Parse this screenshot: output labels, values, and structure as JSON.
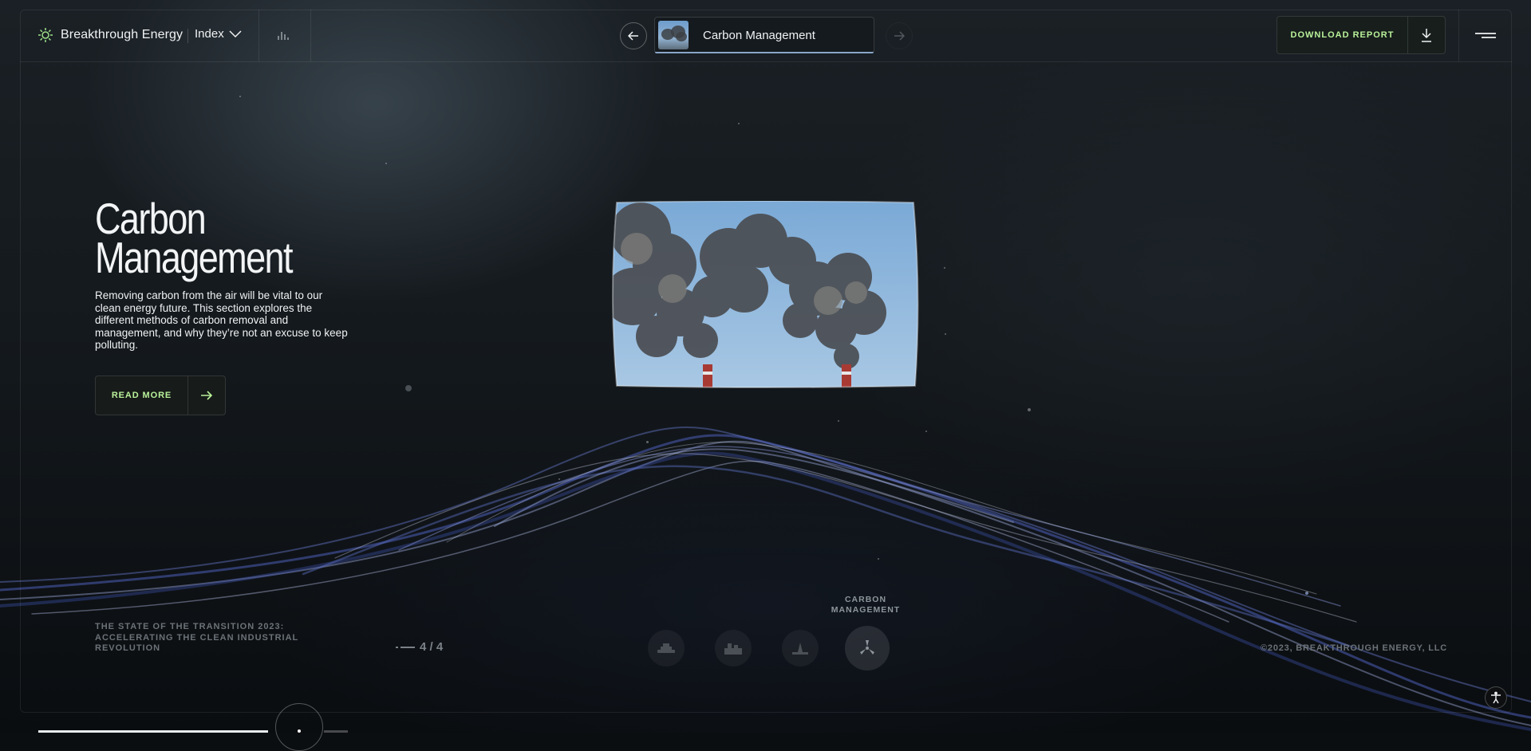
{
  "header": {
    "brand_name": "Breakthrough Energy",
    "index_label": "Index",
    "chapter_title": "Carbon Management",
    "download_label": "DOWNLOAD REPORT"
  },
  "hero": {
    "title_line1": "Carbon",
    "title_line2": "Management",
    "description": "Removing carbon from the air will be vital to our clean energy future. This section explores the different methods of carbon removal and management, and why they’re not an excuse to keep polluting.",
    "read_more_label": "READ MORE"
  },
  "footer": {
    "report_title_line1": "THE STATE OF THE TRANSITION 2023:",
    "report_title_line2": "ACCELERATING THE CLEAN INDUSTRIAL",
    "report_title_line3": "REVOLUTION",
    "pager": "4 / 4",
    "copyright": "©2023, BREAKTHROUGH ENERGY, LLC"
  },
  "chapters": {
    "active_label_line1": "CARBON",
    "active_label_line2": "MANAGEMENT",
    "items": [
      {
        "icon": "ship-icon",
        "active": false
      },
      {
        "icon": "factory-icon",
        "active": false
      },
      {
        "icon": "industry-icon",
        "active": false
      },
      {
        "icon": "carbon-capture-icon",
        "active": true
      }
    ]
  },
  "colors": {
    "accent_green": "#b9f29a",
    "background": "#0b0e11",
    "wave_blue": "#5b6fc4"
  }
}
